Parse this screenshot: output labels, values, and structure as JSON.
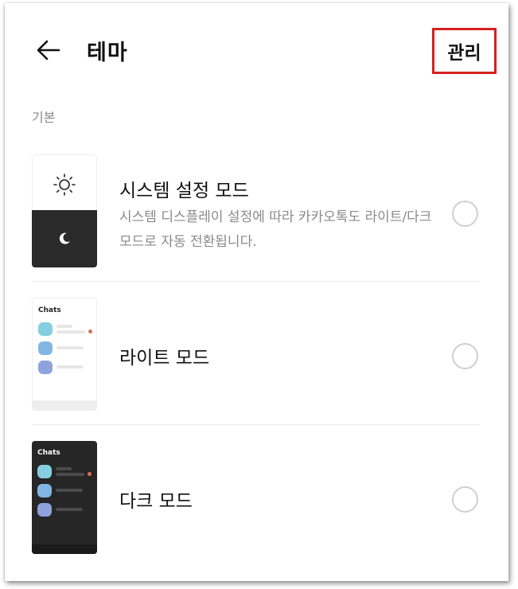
{
  "header": {
    "back_icon": "arrow-left-icon",
    "title": "테마",
    "manage_label": "관리"
  },
  "section": {
    "label": "기본"
  },
  "options": [
    {
      "title": "시스템 설정 모드",
      "description": "시스템 디스플레이 설정에 따라 카카오톡도 라이트/다크 모드로 자동 전환됩니다.",
      "selected": false,
      "icons": [
        "sun-icon",
        "moon-icon"
      ]
    },
    {
      "title": "라이트 모드",
      "preview_label": "Chats",
      "selected": false
    },
    {
      "title": "다크 모드",
      "preview_label": "Chats",
      "selected": false
    }
  ],
  "colors": {
    "highlight_border": "#d62020",
    "avatar_1": "#86cfe0",
    "avatar_2": "#82b6e2",
    "avatar_3": "#8ea3dc",
    "unread_dot": "#e26a5a"
  }
}
